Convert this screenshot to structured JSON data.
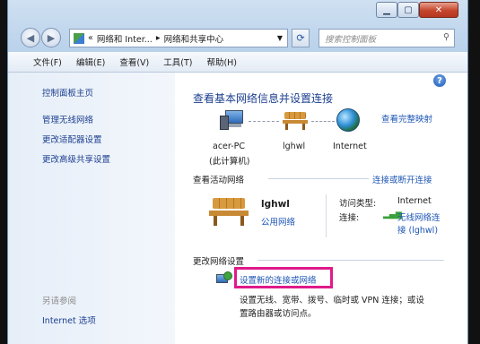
{
  "nav": {
    "breadcrumb_prefix": "«",
    "breadcrumb_1": "网络和 Inter...",
    "breadcrumb_sep": "▸",
    "breadcrumb_2": "网络和共享中心",
    "search_placeholder": "搜索控制面板"
  },
  "menu": [
    "文件(F)",
    "编辑(E)",
    "查看(V)",
    "工具(T)",
    "帮助(H)"
  ],
  "sidebar": {
    "home": "控制面板主页",
    "items": [
      "管理无线网络",
      "更改适配器设置",
      "更改高级共享设置"
    ],
    "see_also_title": "另请参阅",
    "see_also_items": [
      "Internet 选项"
    ]
  },
  "main": {
    "title": "查看基本网络信息并设置连接",
    "view_full_map": "查看完整映射",
    "nodes": [
      {
        "label": "acer-PC",
        "sublabel": "(此计算机)",
        "icon": "computer-icon"
      },
      {
        "label": "lghwl",
        "sublabel": "",
        "icon": "bench-icon"
      },
      {
        "label": "Internet",
        "sublabel": "",
        "icon": "globe-icon"
      }
    ],
    "active_title": "查看活动网络",
    "connect_link": "连接或断开连接",
    "network": {
      "name": "lghwl",
      "type": "公用网络",
      "access_label": "访问类型:",
      "access_value": "Internet",
      "conn_label": "连接:",
      "conn_value_1": "无线网络连",
      "conn_value_2": "接 (lghwl)"
    },
    "change_title": "更改网络设置",
    "setup_link": "设置新的连接或网络",
    "setup_desc_1": "设置无线、宽带、拨号、临时或 VPN 连接；或设",
    "setup_desc_2": "置路由器或访问点。"
  },
  "colors": {
    "link": "#1c55b4",
    "highlight": "#e01a8a",
    "close": "#c5452c"
  }
}
